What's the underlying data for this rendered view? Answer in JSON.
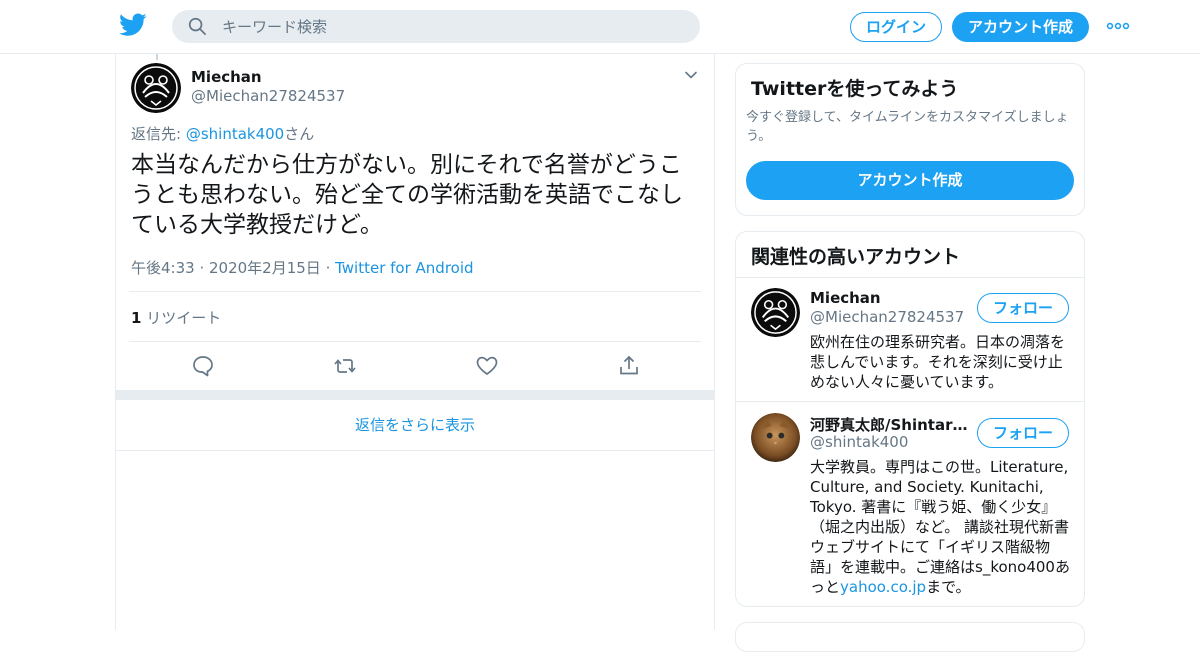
{
  "header": {
    "search_placeholder": "キーワード検索",
    "login_label": "ログイン",
    "signup_label": "アカウント作成"
  },
  "tweet": {
    "author_name": "Miechan",
    "author_handle": "@Miechan27824537",
    "reply_prefix": "返信先: ",
    "reply_to_handle": "@shintak400",
    "reply_suffix": "さん",
    "text": "本当なんだから仕方がない。別にそれで名誉がどうこうとも思わない。殆ど全ての学術活動を英語でこなしている大学教授だけど。",
    "timestamp": "午後4:33 · 2020年2月15日",
    "separator": " · ",
    "source": "Twitter for Android",
    "retweet_count": "1",
    "retweet_label": " リツイート"
  },
  "more_replies_label": "返信をさらに表示",
  "sidebar": {
    "signup_card": {
      "title": "Twitterを使ってみよう",
      "description": "今すぐ登録して、タイムラインをカスタマイズしましょう。",
      "button_label": "アカウント作成"
    },
    "related": {
      "title": "関連性の高いアカウント",
      "accounts": [
        {
          "name": "Miechan",
          "handle": "@Miechan27824537",
          "follow_label": "フォロー",
          "bio": "欧州在住の理系研究者。日本の凋落を悲しんでいます。それを深刻に受け止めない人々に憂いています。"
        },
        {
          "name": "河野真太郎/Shintaro…",
          "handle": "@shintak400",
          "follow_label": "フォロー",
          "bio": "大学教員。専門はこの世。Literature, Culture, and Society. Kunitachi, Tokyo. 著書に『戦う姫、働く少女』（堀之内出版）など。 講談社現代新書ウェブサイトにて「イギリス階級物語」を連載中。ご連絡はs_kono400あっと",
          "bio_link": "yahoo.co.jp",
          "bio_suffix": "まで。"
        }
      ]
    }
  },
  "colors": {
    "brand": "#1da1f2",
    "link": "#1b95e0",
    "secondary_text": "#657786",
    "border": "#e6ecf0"
  },
  "icons": [
    "twitter-logo-icon",
    "search-icon",
    "more-icon",
    "chevron-down-icon",
    "reply-icon",
    "retweet-icon",
    "like-icon",
    "share-icon"
  ]
}
